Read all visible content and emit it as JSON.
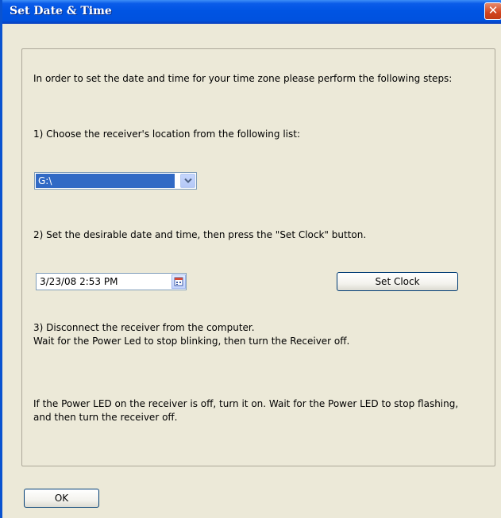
{
  "window": {
    "title": "Set Date & Time",
    "close_glyph": "✕"
  },
  "instructions": {
    "intro": "In order to set the date and time for your time zone please perform the following steps:",
    "step1": "1) Choose the receiver's location from the following list:",
    "step2": "2) Set the desirable date and time, then press the \"Set Clock\" button.",
    "step3_line1": "3) Disconnect the receiver from the computer.",
    "step3_line2": "Wait for the Power Led to stop blinking, then turn the Receiver off.",
    "note_line1": "If the Power LED on the receiver is off, turn it on. Wait for the Power LED to stop flashing,",
    "note_line2": "and then turn the receiver off."
  },
  "location_select": {
    "selected": "G:\\",
    "icon": "chevron-down-icon"
  },
  "datetime_picker": {
    "value": "3/23/08 2:53 PM",
    "icon": "calendar-icon"
  },
  "buttons": {
    "set_clock": "Set Clock",
    "ok": "OK"
  },
  "colors": {
    "title_bar": "#0054e3",
    "selection": "#316ac5",
    "close": "#d2441f"
  }
}
